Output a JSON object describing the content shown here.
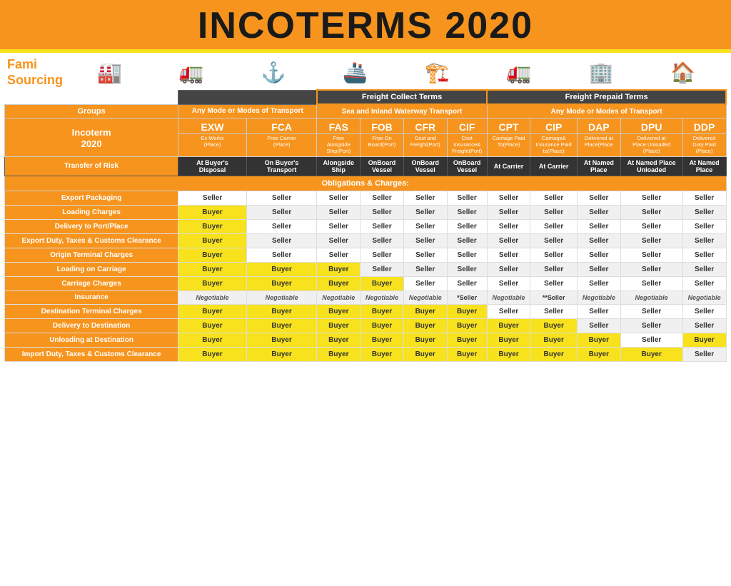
{
  "header": {
    "title": "INCOTERMS 2020"
  },
  "logo": {
    "line1": "Fami",
    "line2": "Sourcing"
  },
  "icons": [
    "🏭",
    "🚛",
    "⚓",
    "🚢",
    "🏗️",
    "🚛",
    "🏢",
    "🏠"
  ],
  "freight": {
    "collect_label": "Freight Collect Terms",
    "prepaid_label": "Freight Prepaid Terms"
  },
  "groups": {
    "label": "Groups",
    "any_mode": "Any Mode or Modes of Transport",
    "sea_inland": "Sea and Inland Waterway Transport",
    "any_mode2": "Any Mode or Modes of Transport"
  },
  "incoterm_label": "Incoterm\n2020",
  "codes": [
    "EXW",
    "FCA",
    "FAS",
    "FOB",
    "CFR",
    "CIF",
    "CPT",
    "CIP",
    "DAP",
    "DPU",
    "DDP"
  ],
  "sublabels": [
    "Ex Works\n(Place)",
    "Free Carrier\n(Place)",
    "Free\nAlongside\nShip(Port)",
    "Free On\nBoard(Port)",
    "Cost and\nFreight(Port)",
    "Cost\nInsurance&\nFreight(Port)",
    "Carriage Paid\nTo(Place)",
    "Carriage&\nInsurance Paid\nto(Place)",
    "Delivered at\nPlace(Place",
    "Delivered at\nPlace Unloaded\n(Place)",
    "Delivered\nDuty Paid\n(Place)"
  ],
  "transfer_label": "Transfer of Risk",
  "transfer_values": [
    "At Buyer's\nDisposal",
    "On Buyer's\nTransport",
    "Alongside\nShip",
    "OnBoard\nVessel",
    "OnBoard\nVessel",
    "OnBoard\nVessel",
    "At Carrier",
    "At Carrier",
    "At Named\nPlace",
    "At Named Place\nUnloaded",
    "At Named\nPlace"
  ],
  "obligations_label": "Obligations & Charges:",
  "rows": [
    {
      "label": "Export Packaging",
      "values": [
        "Seller",
        "Seller",
        "Seller",
        "Seller",
        "Seller",
        "Seller",
        "Seller",
        "Seller",
        "Seller",
        "Seller",
        "Seller"
      ],
      "highlights": []
    },
    {
      "label": "Loading Charges",
      "values": [
        "Buyer",
        "Seller",
        "Seller",
        "Seller",
        "Seller",
        "Seller",
        "Seller",
        "Seller",
        "Seller",
        "Seller",
        "Seller"
      ],
      "highlights": [
        0
      ]
    },
    {
      "label": "Delivery to Port/Place",
      "values": [
        "Buyer",
        "Seller",
        "Seller",
        "Seller",
        "Seller",
        "Seller",
        "Seller",
        "Seller",
        "Seller",
        "Seller",
        "Seller"
      ],
      "highlights": [
        0
      ]
    },
    {
      "label": "Export Duty, Taxes & Customs Clearance",
      "values": [
        "Buyer",
        "Seller",
        "Seller",
        "Seller",
        "Seller",
        "Seller",
        "Seller",
        "Seller",
        "Seller",
        "Seller",
        "Seller"
      ],
      "highlights": [
        0
      ]
    },
    {
      "label": "Origin Terminal Charges",
      "values": [
        "Buyer",
        "Seller",
        "Seller",
        "Seller",
        "Seller",
        "Seller",
        "Seller",
        "Seller",
        "Seller",
        "Seller",
        "Seller"
      ],
      "highlights": [
        0
      ]
    },
    {
      "label": "Loading on Carriage",
      "values": [
        "Buyer",
        "Buyer",
        "Buyer",
        "Seller",
        "Seller",
        "Seller",
        "Seller",
        "Seller",
        "Seller",
        "Seller",
        "Seller"
      ],
      "highlights": [
        0,
        1,
        2
      ]
    },
    {
      "label": "Carriage Charges",
      "values": [
        "Buyer",
        "Buyer",
        "Buyer",
        "Buyer",
        "Seller",
        "Seller",
        "Seller",
        "Seller",
        "Seller",
        "Seller",
        "Seller"
      ],
      "highlights": [
        0,
        1,
        2,
        3
      ]
    },
    {
      "label": "Insurance",
      "values": [
        "Negotiable",
        "Negotiable",
        "Negotiable",
        "Negotiable",
        "Negotiable",
        "*Seller",
        "Negotiable",
        "**Seller",
        "Negotiable",
        "Negotiable",
        "Negotiable"
      ],
      "highlights": [],
      "negotiable": true
    },
    {
      "label": "Destination Terminal Charges",
      "values": [
        "Buyer",
        "Buyer",
        "Buyer",
        "Buyer",
        "Buyer",
        "Buyer",
        "Seller",
        "Seller",
        "Seller",
        "Seller",
        "Seller"
      ],
      "highlights": [
        0,
        1,
        2,
        3,
        4,
        5
      ]
    },
    {
      "label": "Delivery to Destination",
      "values": [
        "Buyer",
        "Buyer",
        "Buyer",
        "Buyer",
        "Buyer",
        "Buyer",
        "Buyer",
        "Buyer",
        "Seller",
        "Seller",
        "Seller"
      ],
      "highlights": [
        0,
        1,
        2,
        3,
        4,
        5,
        6,
        7
      ]
    },
    {
      "label": "Unloading at Destination",
      "values": [
        "Buyer",
        "Buyer",
        "Buyer",
        "Buyer",
        "Buyer",
        "Buyer",
        "Buyer",
        "Buyer",
        "Buyer",
        "Seller",
        "Buyer"
      ],
      "highlights": [
        0,
        1,
        2,
        3,
        4,
        5,
        6,
        7,
        8,
        10
      ]
    },
    {
      "label": "Import Duty, Taxes & Customs Clearance",
      "values": [
        "Buyer",
        "Buyer",
        "Buyer",
        "Buyer",
        "Buyer",
        "Buyer",
        "Buyer",
        "Buyer",
        "Buyer",
        "Buyer",
        "Seller"
      ],
      "highlights": [
        0,
        1,
        2,
        3,
        4,
        5,
        6,
        7,
        8,
        9
      ]
    }
  ]
}
